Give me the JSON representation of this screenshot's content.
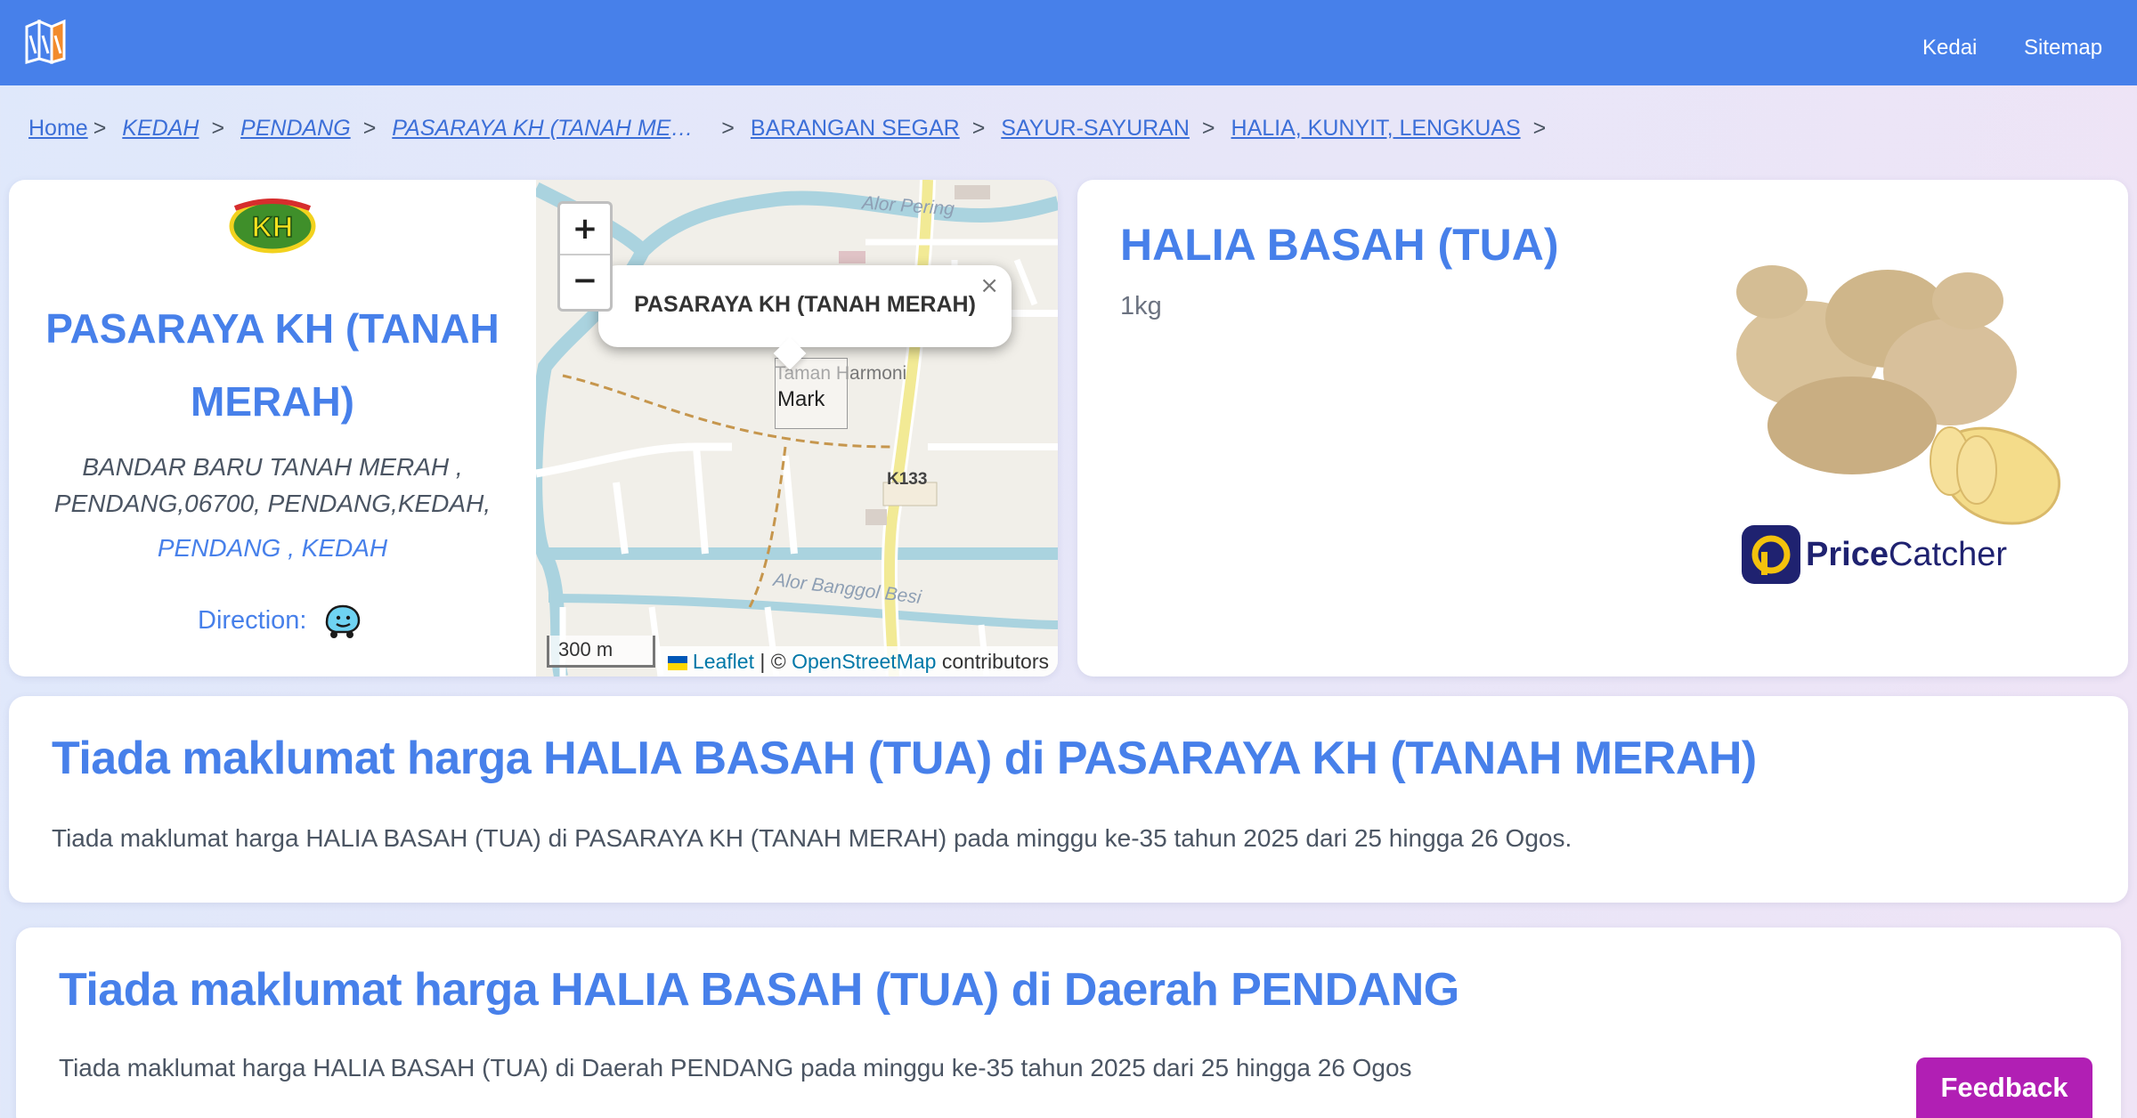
{
  "header": {
    "logo_icon": "site-logo-icon",
    "nav": [
      {
        "label": "Kedai"
      },
      {
        "label": "Sitemap"
      }
    ],
    "color": "#4780ea"
  },
  "breadcrumb": {
    "items": [
      {
        "label": "Home"
      },
      {
        "label": "KEDAH"
      },
      {
        "label": "PENDANG"
      },
      {
        "label": "PASARAYA KH (TANAH MERAH)"
      },
      {
        "label": "BARANGAN SEGAR"
      },
      {
        "label": "SAYUR-SAYURAN"
      },
      {
        "label": "HALIA, KUNYIT, LENGKUAS"
      }
    ],
    "separator": ">"
  },
  "store": {
    "logo_text": "KH",
    "name": "PASARAYA KH (TANAH MERAH)",
    "address": "BANDAR BARU TANAH MERAH , PENDANG,06700, PENDANG,KEDAH,",
    "region": "PENDANG , KEDAH",
    "direction_label": "Direction:",
    "direction_icon": "waze-icon"
  },
  "map": {
    "zoom_in": "+",
    "zoom_out": "−",
    "popup_text": "PASARAYA KH (TANAH MERAH)",
    "popup_close": "×",
    "marker_alt": "Mark",
    "scale": "300 m",
    "attribution_leaflet": "Leaflet",
    "attribution_sep": "| ©",
    "attribution_osm": "OpenStreetMap",
    "attribution_tail": "contributors",
    "labels": {
      "river_top": "Alor Pering",
      "river_bottom": "Alor Banggol Besi",
      "road": "K133",
      "area": "Taman Harmoni"
    }
  },
  "product": {
    "name": "HALIA BASAH (TUA)",
    "unit": "1kg",
    "badge_brand_bold": "Price",
    "badge_brand_rest": "Catcher"
  },
  "info": [
    {
      "title": "Tiada maklumat harga HALIA BASAH (TUA) di PASARAYA KH (TANAH MERAH)",
      "body": "Tiada maklumat harga HALIA BASAH (TUA) di PASARAYA KH (TANAH MERAH) pada minggu ke-35 tahun 2025 dari 25 hingga 26 Ogos."
    },
    {
      "title": "Tiada maklumat harga HALIA BASAH (TUA) di Daerah PENDANG",
      "body": "Tiada maklumat harga HALIA BASAH (TUA) di Daerah PENDANG pada minggu ke-35 tahun 2025 dari 25 hingga 26 Ogos"
    }
  ],
  "feedback": {
    "label": "Feedback",
    "color": "#b11fb4"
  }
}
